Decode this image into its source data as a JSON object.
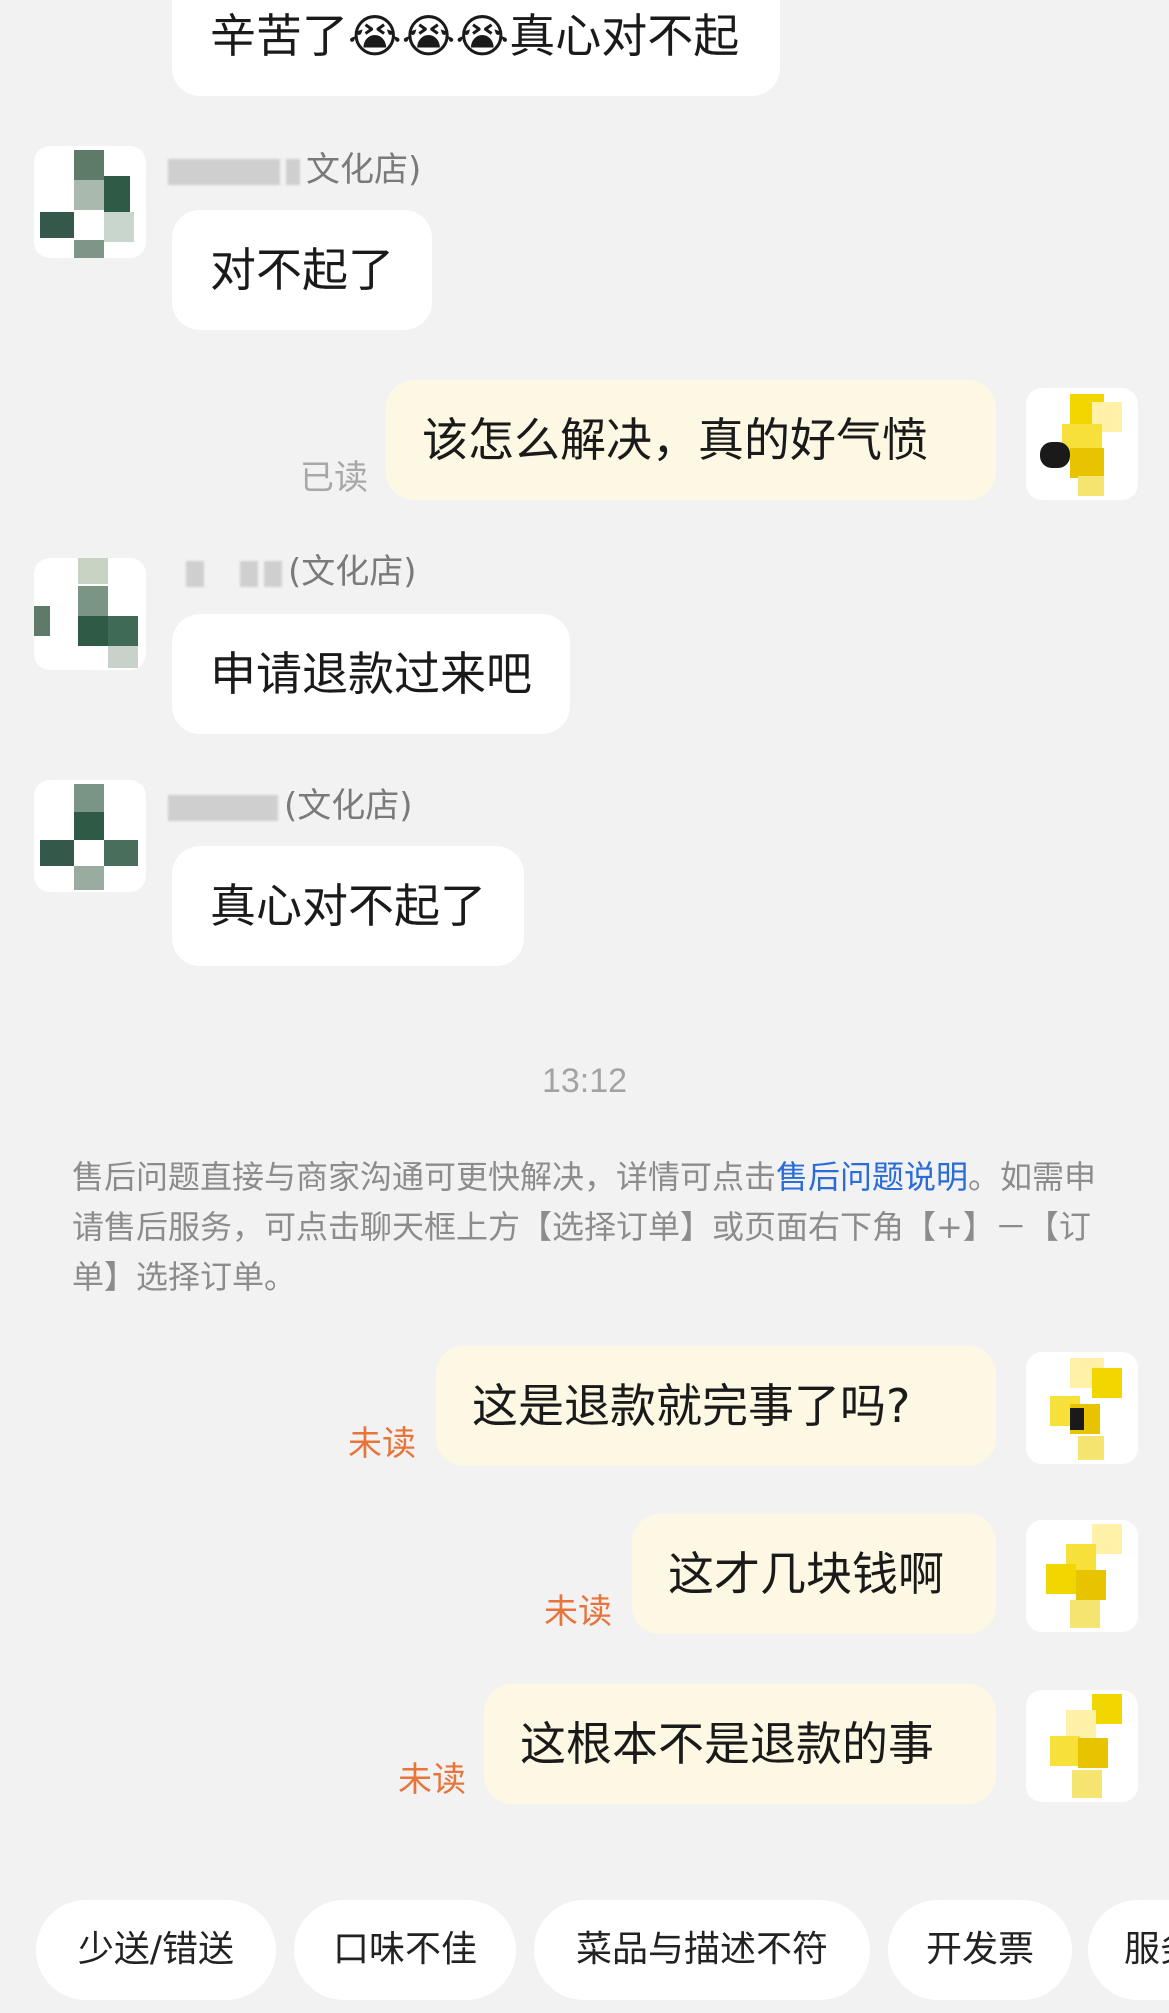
{
  "messages": [
    {
      "side": "in",
      "text": "辛苦了😭😭😭真心对不起"
    },
    {
      "side": "in",
      "sender_suffix": "文化店)",
      "text": "对不起了"
    },
    {
      "side": "out",
      "text": "该怎么解决，真的好气愤",
      "status": "已读"
    },
    {
      "side": "in",
      "sender_suffix": "(文化店)",
      "text": "申请退款过来吧"
    },
    {
      "side": "in",
      "sender_suffix": "(文化店)",
      "text": "真心对不起了"
    },
    {
      "side": "out",
      "text": "这是退款就完事了吗?",
      "status": "未读"
    },
    {
      "side": "out",
      "text": "这才几块钱啊",
      "status": "未读"
    },
    {
      "side": "out",
      "text": "这根本不是退款的事",
      "status": "未读"
    }
  ],
  "time_divider": "13:12",
  "system_notice": {
    "text_before": "售后问题直接与商家沟通可更快解决，详情可点击",
    "link_text": "售后问题说明",
    "text_after": "。如需申请售后服务，可点击聊天框上方【选择订单】或页面右下角【+】－【订单】选择订单。"
  },
  "quick_replies": [
    "少送/错送",
    "口味不佳",
    "菜品与描述不符",
    "开发票",
    "服务"
  ],
  "colors": {
    "background": "#f2f2f2",
    "incoming_bubble": "#ffffff",
    "outgoing_bubble": "#fdf8e3",
    "read_status": "#a8a8a8",
    "unread_status": "#e8743b",
    "link": "#2b6cd8"
  }
}
